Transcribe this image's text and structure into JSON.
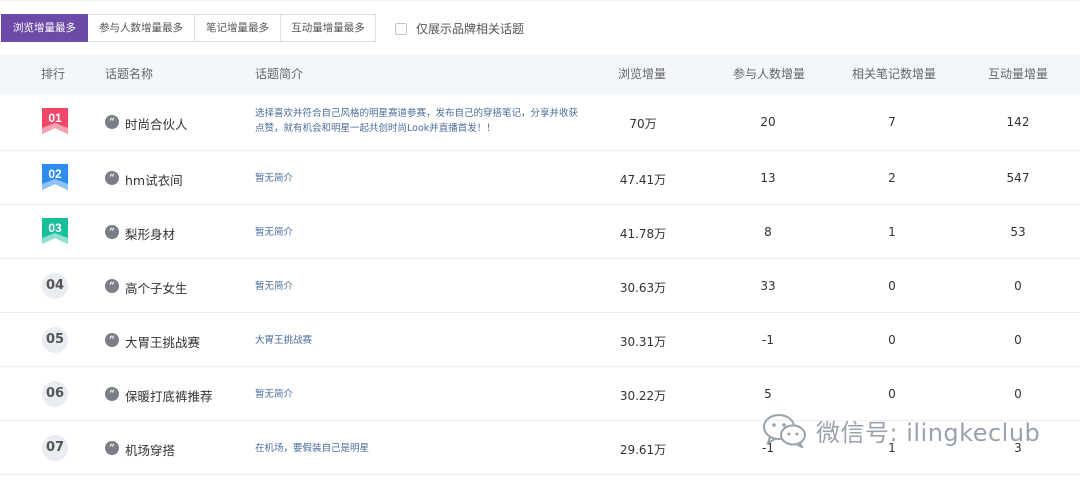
{
  "tabs": [
    {
      "label": "浏览增量最多",
      "active": true
    },
    {
      "label": "参与人数增量最多",
      "active": false
    },
    {
      "label": "笔记增量最多",
      "active": false
    },
    {
      "label": "互动量增量最多",
      "active": false
    }
  ],
  "filter": {
    "label": "仅展示品牌相关话题",
    "checked": false
  },
  "table": {
    "headers": {
      "rank": "排行",
      "name": "话题名称",
      "intro": "话题简介",
      "views": "浏览增量",
      "participants": "参与人数增量",
      "notes": "相关笔记数增量",
      "interactions": "互动量增量"
    },
    "rows": [
      {
        "rank": "01",
        "name": "时尚合伙人",
        "intro": "选择喜欢并符合自己风格的明星赛道参赛，发布自己的穿搭笔记，分享并收获点赞，就有机会和明星一起共创时尚Look并直播首发！！",
        "views": "70万",
        "participants": "20",
        "notes": "7",
        "interactions": "142"
      },
      {
        "rank": "02",
        "name": "hm试衣间",
        "intro": "暂无简介",
        "views": "47.41万",
        "participants": "13",
        "notes": "2",
        "interactions": "547"
      },
      {
        "rank": "03",
        "name": "梨形身材",
        "intro": "暂无简介",
        "views": "41.78万",
        "participants": "8",
        "notes": "1",
        "interactions": "53"
      },
      {
        "rank": "04",
        "name": "高个子女生",
        "intro": "暂无简介",
        "views": "30.63万",
        "participants": "33",
        "notes": "0",
        "interactions": "0"
      },
      {
        "rank": "05",
        "name": "大胃王挑战赛",
        "intro": "大胃王挑战赛",
        "views": "30.31万",
        "participants": "-1",
        "notes": "0",
        "interactions": "0"
      },
      {
        "rank": "06",
        "name": "保暖打底裤推荐",
        "intro": "暂无简介",
        "views": "30.22万",
        "participants": "5",
        "notes": "0",
        "interactions": "0"
      },
      {
        "rank": "07",
        "name": "机场穿搭",
        "intro": "在机场，要假装自己是明星",
        "views": "29.61万",
        "participants": "-1",
        "notes": "1",
        "interactions": "3"
      }
    ]
  },
  "badge_colors": {
    "01": "#f0476b",
    "02": "#2d8cf0",
    "03": "#19be9b"
  },
  "watermark": {
    "text": "微信号: ilingkeclub",
    "icon": "wechat-icon"
  }
}
